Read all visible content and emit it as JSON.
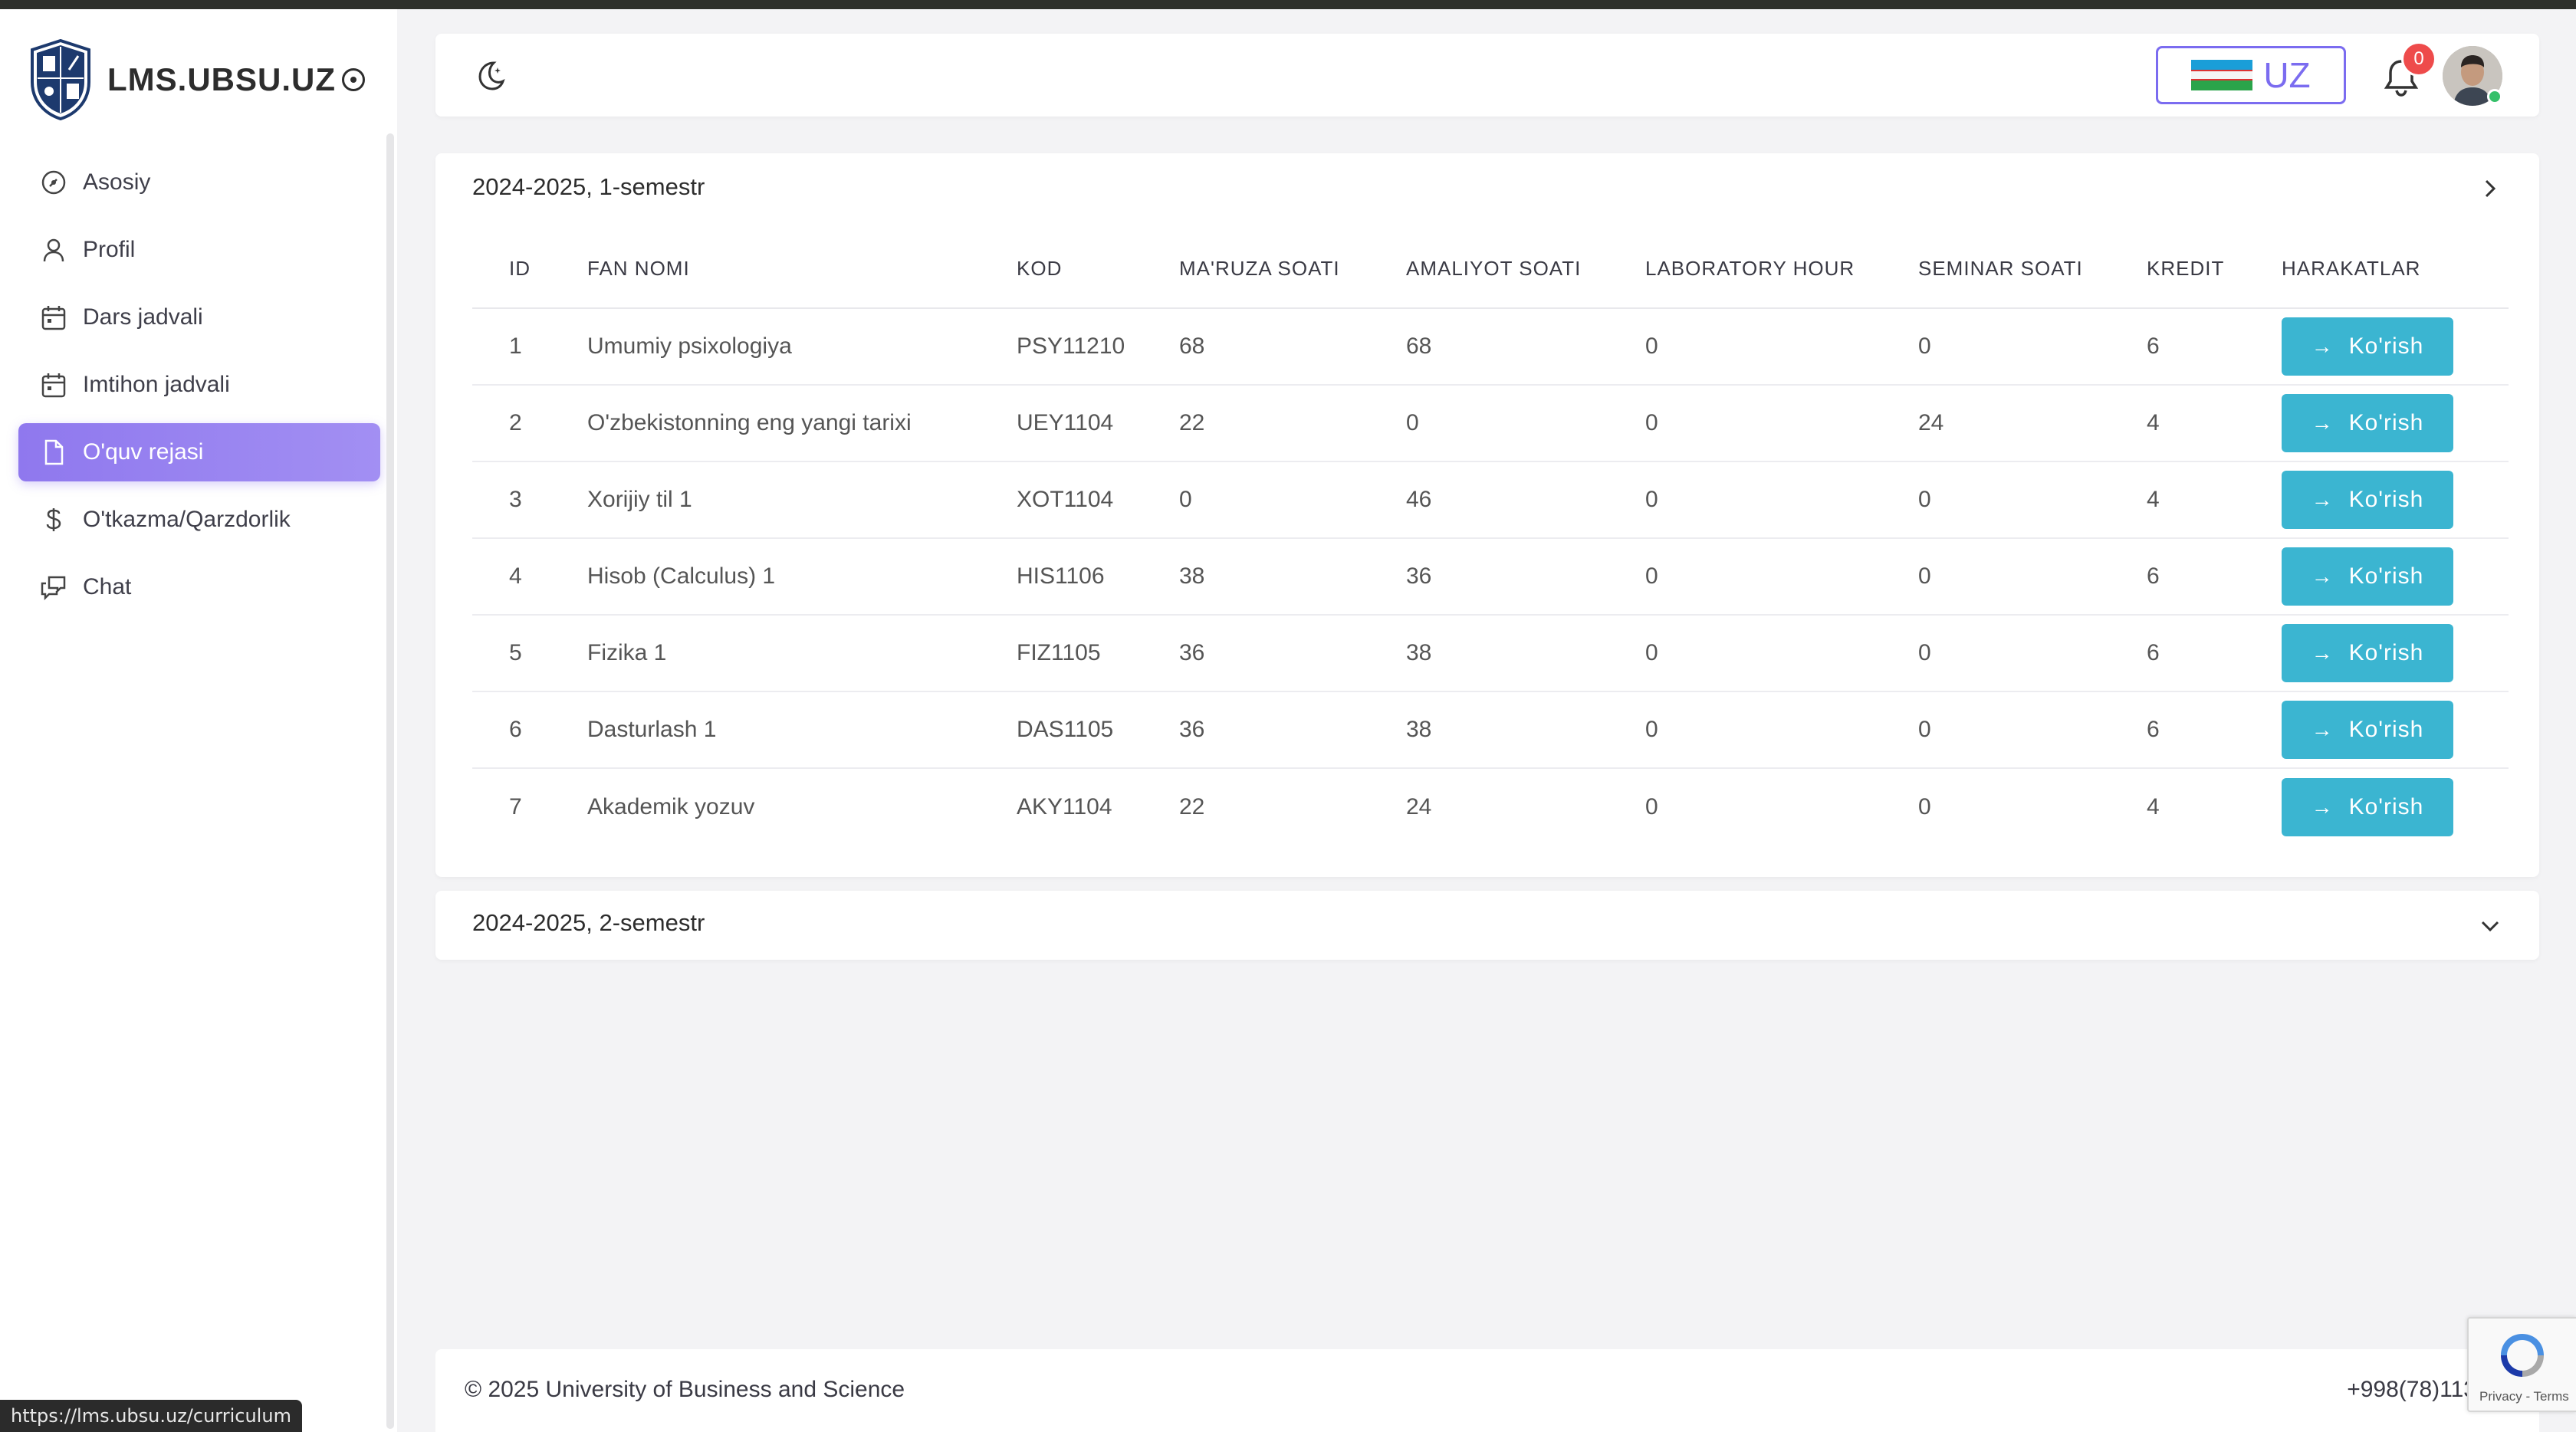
{
  "brand": {
    "title": "LMS.UBSU.UZ"
  },
  "sidebar": {
    "items": [
      {
        "label": "Asosiy",
        "icon": "dashboard-icon"
      },
      {
        "label": "Profil",
        "icon": "user-icon"
      },
      {
        "label": "Dars jadvali",
        "icon": "calendar-icon"
      },
      {
        "label": "Imtihon jadvali",
        "icon": "calendar-icon"
      },
      {
        "label": "O'quv rejasi",
        "icon": "document-icon",
        "active": true
      },
      {
        "label": "O'tkazma/Qarzdorlik",
        "icon": "dollar-icon"
      },
      {
        "label": "Chat",
        "icon": "chat-icon"
      }
    ]
  },
  "header": {
    "language": "UZ",
    "notifications_count": "0"
  },
  "semesters": [
    {
      "title": "2024-2025, 1-semestr",
      "expanded": true
    },
    {
      "title": "2024-2025, 2-semestr",
      "expanded": false
    }
  ],
  "table": {
    "headers": [
      "ID",
      "FAN NOMI",
      "KOD",
      "MA'RUZA SOATI",
      "AMALIYOT SOATI",
      "LABORATORY HOUR",
      "SEMINAR SOATI",
      "KREDIT",
      "HARAKATLAR"
    ],
    "action_label": "Ko'rish",
    "rows": [
      {
        "id": "1",
        "name": "Umumiy psixologiya",
        "kod": "PSY11210",
        "maruza": "68",
        "amaliyot": "68",
        "lab": "0",
        "seminar": "0",
        "kredit": "6"
      },
      {
        "id": "2",
        "name": "O'zbekistonning eng yangi tarixi",
        "kod": "UEY1104",
        "maruza": "22",
        "amaliyot": "0",
        "lab": "0",
        "seminar": "24",
        "kredit": "4"
      },
      {
        "id": "3",
        "name": "Xorijiy til 1",
        "kod": "XOT1104",
        "maruza": "0",
        "amaliyot": "46",
        "lab": "0",
        "seminar": "0",
        "kredit": "4"
      },
      {
        "id": "4",
        "name": "Hisob (Calculus) 1",
        "kod": "HIS1106",
        "maruza": "38",
        "amaliyot": "36",
        "lab": "0",
        "seminar": "0",
        "kredit": "6"
      },
      {
        "id": "5",
        "name": "Fizika 1",
        "kod": "FIZ1105",
        "maruza": "36",
        "amaliyot": "38",
        "lab": "0",
        "seminar": "0",
        "kredit": "6"
      },
      {
        "id": "6",
        "name": "Dasturlash 1",
        "kod": "DAS1105",
        "maruza": "36",
        "amaliyot": "38",
        "lab": "0",
        "seminar": "0",
        "kredit": "6"
      },
      {
        "id": "7",
        "name": "Akademik yozuv",
        "kod": "AKY1104",
        "maruza": "22",
        "amaliyot": "24",
        "lab": "0",
        "seminar": "0",
        "kredit": "4"
      }
    ]
  },
  "footer": {
    "copyright": "© 2025 University of Business and Science",
    "phone": "+998(78)113-26-2"
  },
  "recaptcha": {
    "links": "Privacy - Terms"
  },
  "status_bar": {
    "url": "https://lms.ubsu.uz/curriculum"
  },
  "colors": {
    "accent": "#8f78ee",
    "button": "#3bb5d1",
    "badge": "#ee4b4b"
  }
}
